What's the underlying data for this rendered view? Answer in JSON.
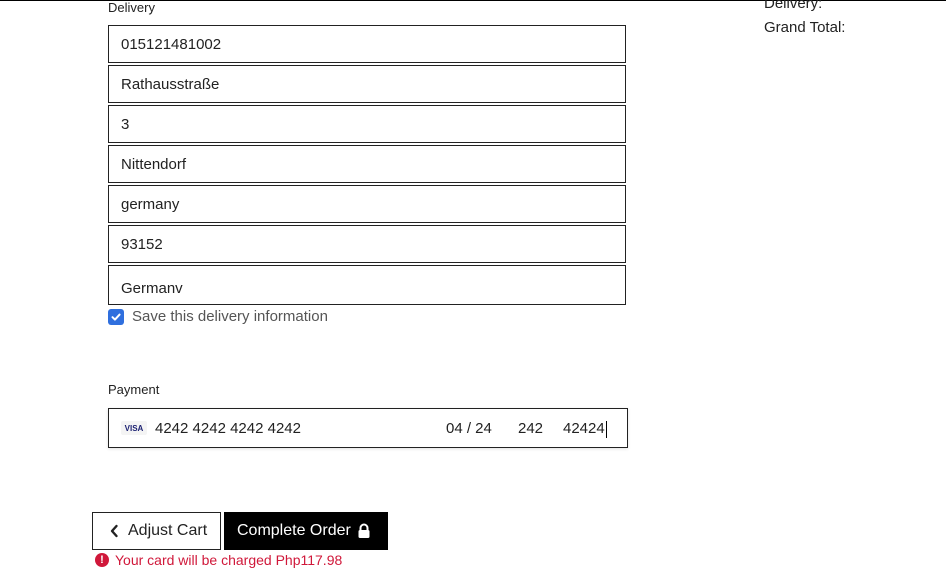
{
  "summary": {
    "delivery_label": "Delivery:",
    "grand_total_label": "Grand Total:"
  },
  "delivery": {
    "label": "Delivery",
    "phone": "015121481002",
    "street": "Rathausstraße",
    "house_number": "3",
    "city": "Nittendorf",
    "state": "germany",
    "postcode": "93152",
    "country": "Germanv",
    "save_label": "Save this delivery information",
    "save_checked": true
  },
  "payment": {
    "label": "Payment",
    "card_brand": "VISA",
    "card_number": "4242 4242 4242 4242",
    "expiry": "04 / 24",
    "cvc": "242",
    "zip": "42424"
  },
  "actions": {
    "adjust_cart": "Adjust Cart",
    "complete_order": "Complete Order"
  },
  "error": {
    "message": "Your card will be charged Php117.98",
    "color": "#d0183a"
  },
  "icons": {
    "checkbox": "check-icon",
    "adjust": "chevron-left-icon",
    "complete": "lock-icon",
    "error": "exclamation-circle-icon"
  }
}
